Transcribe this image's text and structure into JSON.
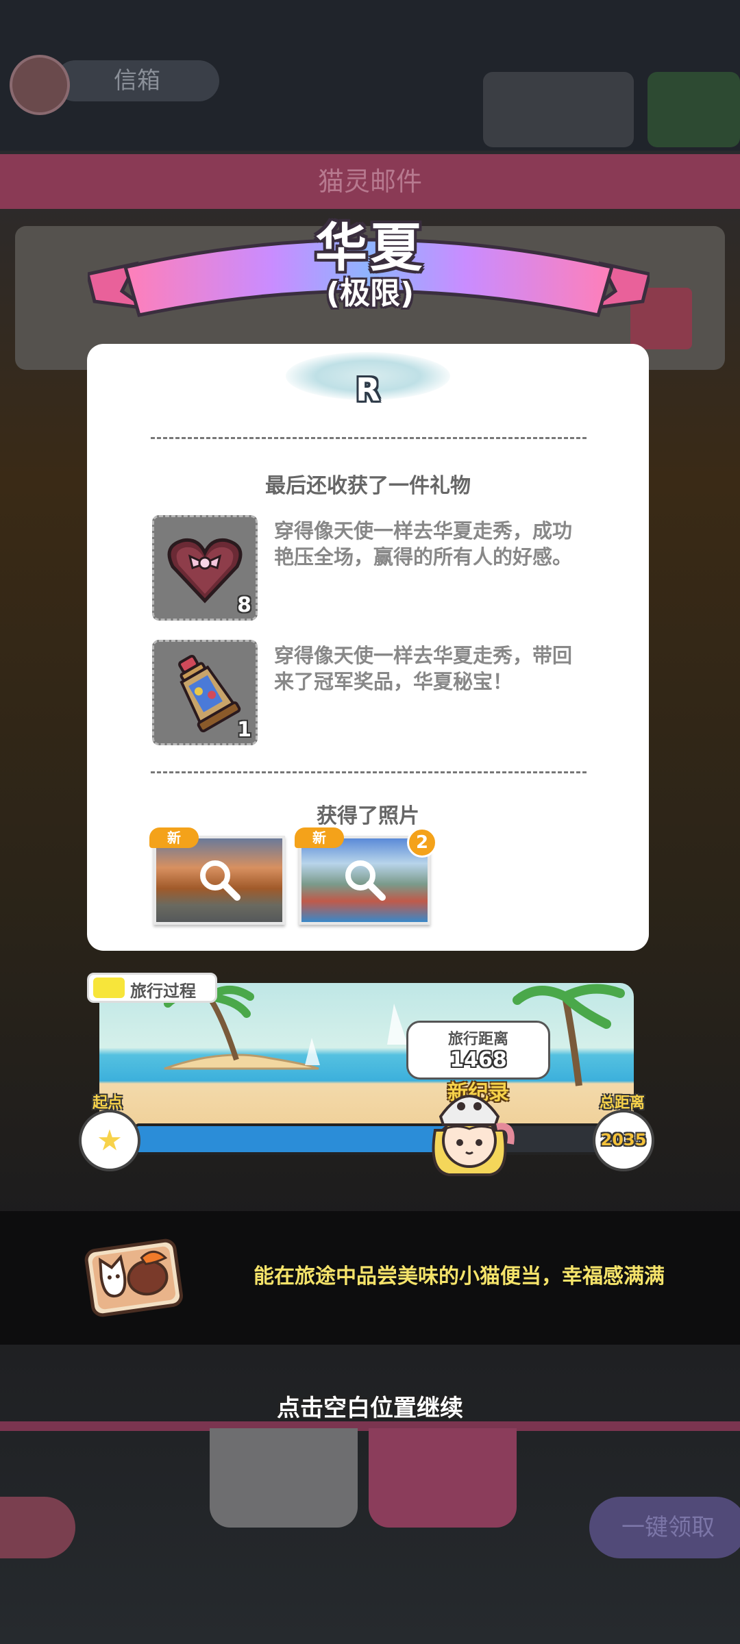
{
  "background": {
    "user_name": "信箱",
    "mail_bar_title": "猫灵邮件",
    "one_click_label": "一键领取"
  },
  "result": {
    "title": "华夏",
    "difficulty": "(极限)",
    "rank": "R"
  },
  "gifts": {
    "section_title": "最后还收获了一件礼物",
    "items": [
      {
        "icon": "heart-gift-box-icon",
        "count": "8",
        "text": "穿得像天使一样去华夏走秀，成功艳压全场，赢得的所有人的好感。"
      },
      {
        "icon": "lantern-trophy-icon",
        "count": "1",
        "text": "穿得像天使一样去华夏走秀，带回来了冠军奖品，华夏秘宝！"
      }
    ]
  },
  "photos": {
    "section_title": "获得了照片",
    "items": [
      {
        "new_label": "新",
        "count": null
      },
      {
        "new_label": "新",
        "count": "2"
      }
    ]
  },
  "travel": {
    "tag_label": "旅行过程",
    "distance_label": "旅行距离",
    "distance_value": "1468",
    "record_label": "新纪录",
    "start_label": "起点",
    "total_label": "总距离",
    "total_value": "2035",
    "progress": 0.72
  },
  "message": {
    "text": "能在旅途中品尝美味的小猫便当，幸福感满满"
  },
  "continue_hint": "点击空白位置继续",
  "colors": {
    "accent_orange": "#f4a21a",
    "record_yellow": "#f7d24a",
    "progress_blue": "#2b8dd8"
  }
}
